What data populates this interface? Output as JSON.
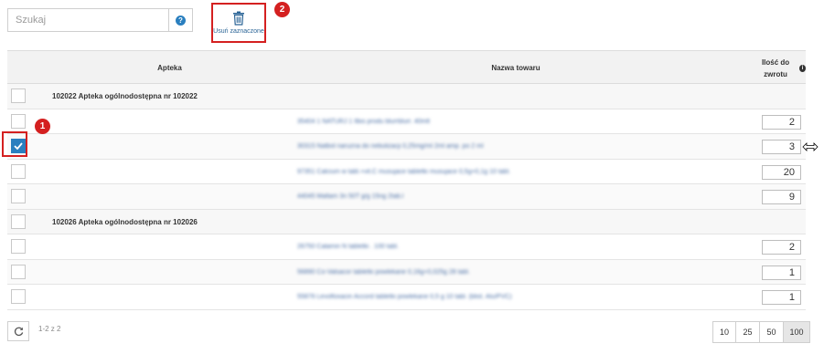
{
  "search": {
    "placeholder": "Szukaj",
    "value": ""
  },
  "help": {
    "label": "?"
  },
  "toolbar": {
    "delete_label": "Usuń zaznaczone"
  },
  "markers": {
    "delete": "2",
    "checkbox": "1"
  },
  "columns": {
    "apteka": "Apteka",
    "nazwa": "Nazwa towaru",
    "ilosc": "Ilość do zwrotu",
    "ilosc_info": "i"
  },
  "groups": [
    {
      "label": "102022 Apteka ogólnodostępna nr 102022",
      "items": [
        {
          "name": "35404 1 NATURJ 1 Ilbis produ blurrblurr. 40mlt",
          "qty": "2",
          "checked": false
        },
        {
          "name": "30315 Natbol naruzna do nebulizacji 0,25mg/ml 2ml amp. po 2 ml",
          "qty": "3",
          "checked": true
        },
        {
          "name": "97351 Calcium w tabl.+vit.C musujace tabletki musujace 0,5g+0,1g 10 tabl.",
          "qty": "20",
          "checked": false
        },
        {
          "name": "44045 Maltam 3n 50T g/g 15ng 2tab.l",
          "qty": "9",
          "checked": false
        }
      ]
    },
    {
      "label": "102026 Apteka ogólnodostępna nr 102026",
      "items": [
        {
          "name": "26750 Calamin N tabletki . 100 tabl.",
          "qty": "2",
          "checked": false
        },
        {
          "name": "56890 Co-Valsacor tabletki powlekane 0,16g+0,025g 28 tabl.",
          "qty": "1",
          "checked": false
        },
        {
          "name": "55876 Levofloxacin Accord tabletki powlekane 0,5 g 10 tabl. (blist. Alu/PVC)",
          "qty": "1",
          "checked": false
        }
      ]
    }
  ],
  "footer": {
    "range": "1-2 z 2",
    "page_sizes": [
      "10",
      "25",
      "50",
      "100"
    ],
    "active_page_size": "100"
  },
  "colors": {
    "accent": "#2a7fbf",
    "highlight": "#d42020"
  },
  "icons": {
    "refresh": "refresh-icon",
    "delete": "trash-icon",
    "help": "question-icon"
  }
}
